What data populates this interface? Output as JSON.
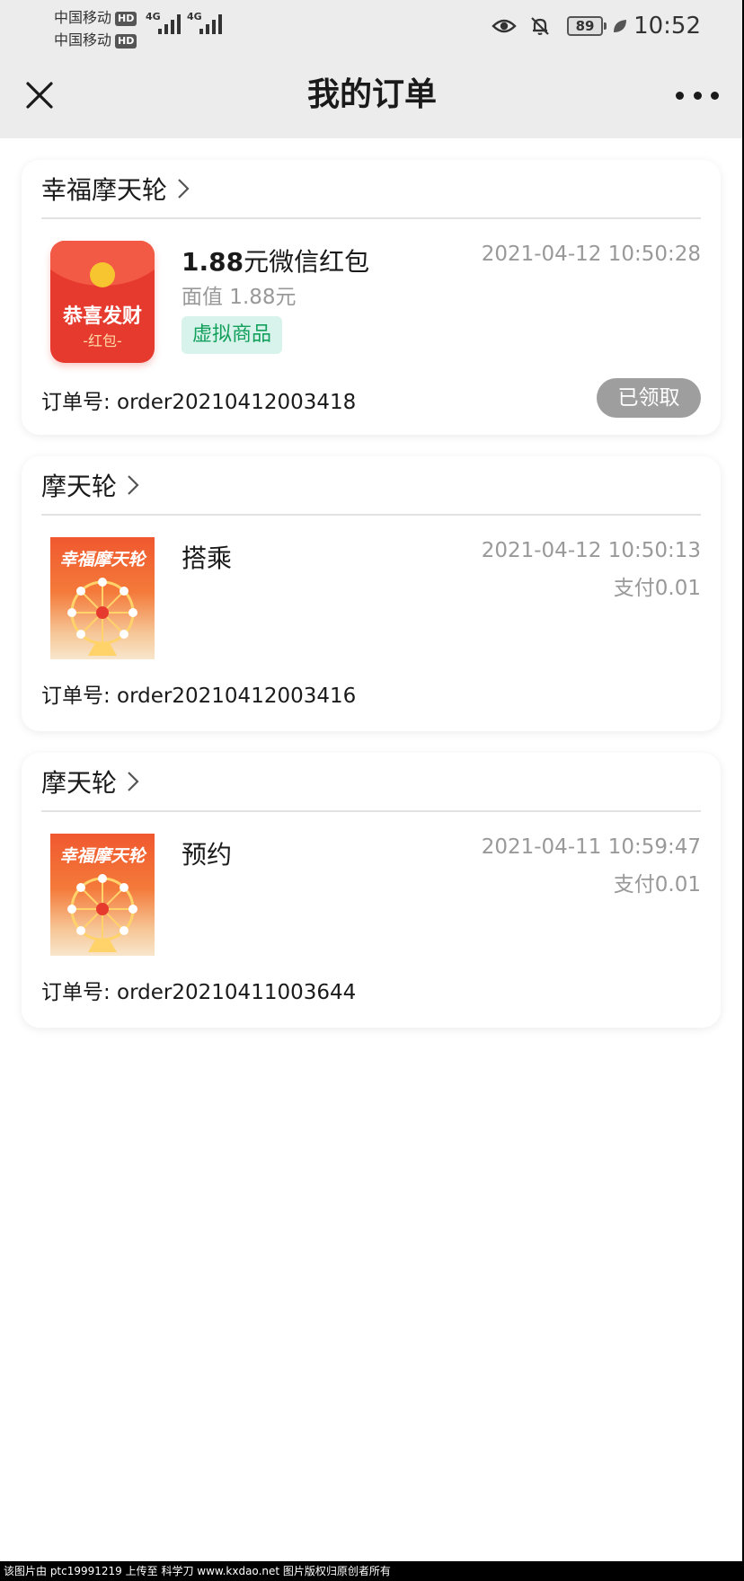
{
  "status_bar": {
    "carrier_1": "中国移动",
    "carrier_2": "中国移动",
    "hd_label": "HD",
    "network_1": "4G",
    "network_2": "4G",
    "battery": "89",
    "time": "10:52"
  },
  "nav": {
    "title": "我的订单",
    "close_icon": "close-icon",
    "more_icon": "more-icon"
  },
  "orders": [
    {
      "shop": "幸福摩天轮",
      "thumbnail": {
        "kind": "red-envelope",
        "main_text": "恭喜发财",
        "small_text": "-红包-"
      },
      "title_amount": "1.88",
      "title_rest": "元微信红包",
      "face_value": "面值  1.88元",
      "tag": "虚拟商品",
      "time": "2021-04-12 10:50:28",
      "order_no": "订单号: order20210412003418",
      "status": "已领取"
    },
    {
      "shop": "摩天轮",
      "thumbnail": {
        "kind": "ferris-poster",
        "main_text": "幸福摩天轮"
      },
      "title": "搭乘",
      "time": "2021-04-12 10:50:13",
      "payment": "支付0.01",
      "order_no": "订单号: order20210412003416"
    },
    {
      "shop": "摩天轮",
      "thumbnail": {
        "kind": "ferris-poster",
        "main_text": "幸福摩天轮"
      },
      "title": "预约",
      "time": "2021-04-11 10:59:47",
      "payment": "支付0.01",
      "order_no": "订单号: order20210411003644"
    }
  ],
  "watermark": "该图片由 ptc19991219 上传至 科学刀 www.kxdao.net 图片版权归原创者所有",
  "colors": {
    "header_bg": "#ececec",
    "tag_bg": "#d8f3ec",
    "tag_text": "#12a05b",
    "status_button": "#9e9e9e",
    "secondary_text": "#999999",
    "envelope_red": "#e63a2e"
  }
}
